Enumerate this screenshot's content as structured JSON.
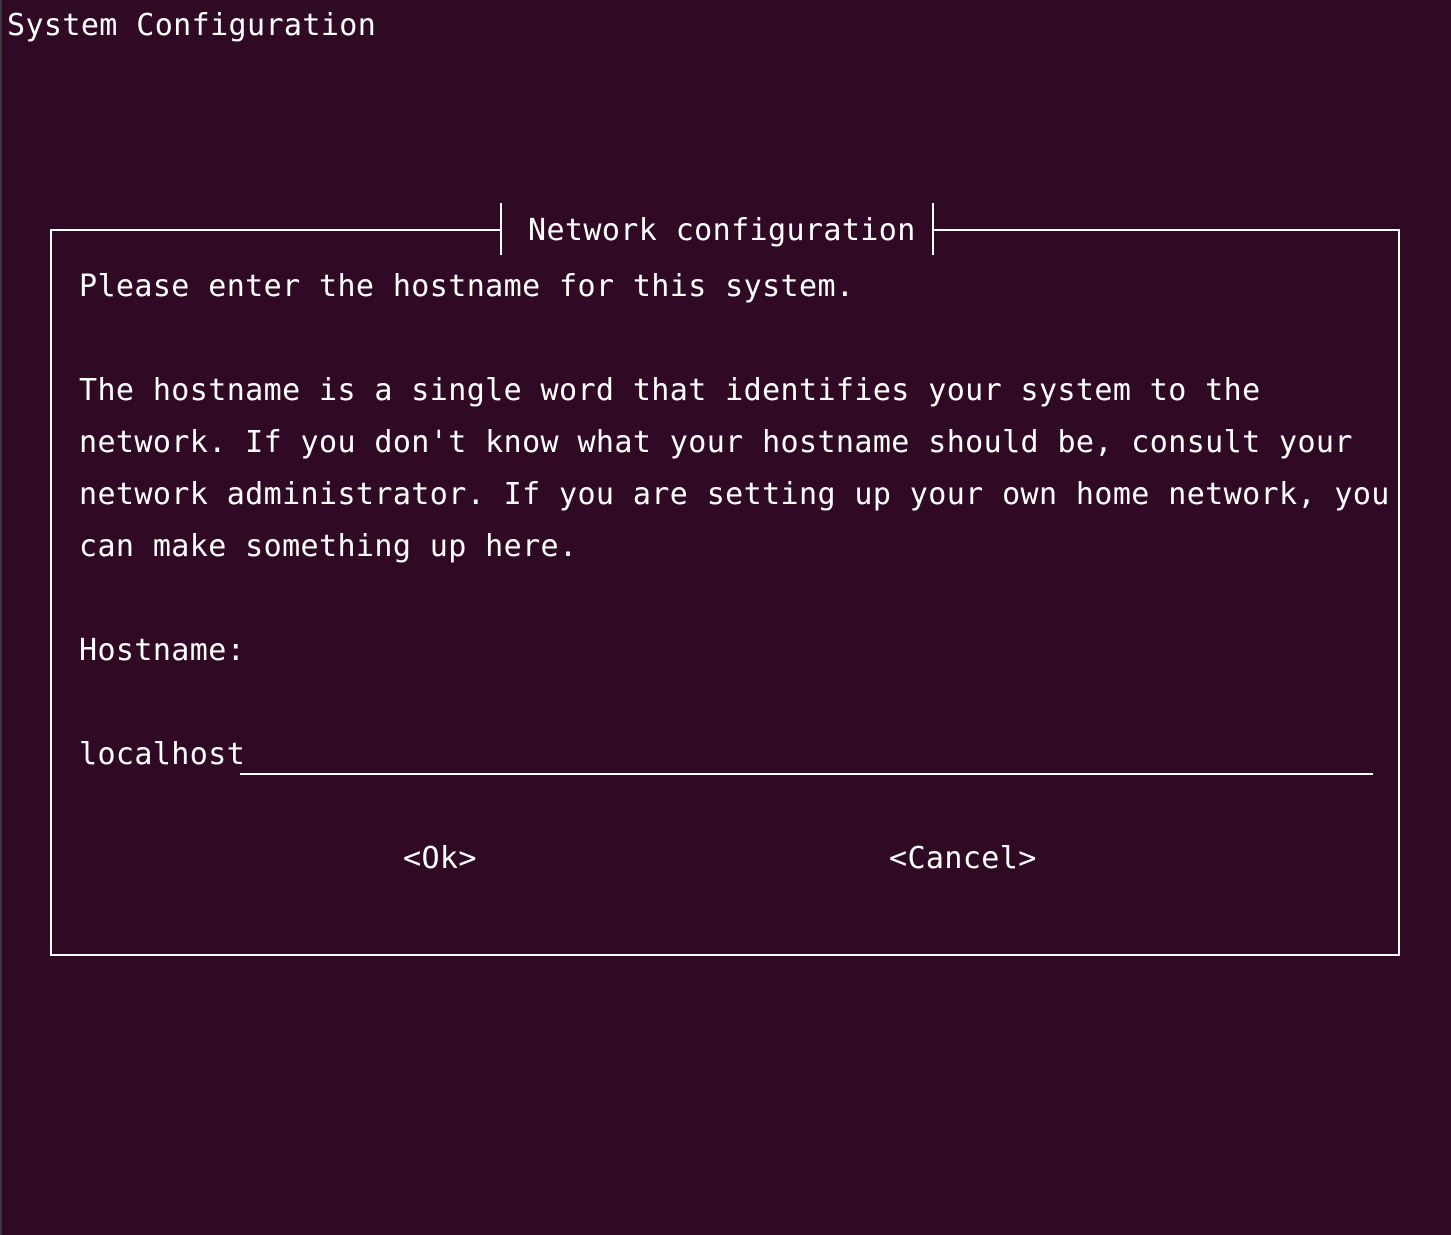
{
  "screen": {
    "title": "System Configuration"
  },
  "dialog": {
    "title": "Network configuration",
    "prompt": "Please enter the hostname for this system.",
    "description_lines": [
      "The hostname is a single word that identifies your system to the",
      "network. If you don't know what your hostname should be, consult your",
      "network administrator. If you are setting up your own home network, you",
      "can make something up here."
    ],
    "field_label": "Hostname:",
    "field_value": "localhost",
    "buttons": {
      "ok": "<Ok>",
      "cancel": "<Cancel>"
    }
  },
  "colors": {
    "background": "#300a24",
    "foreground": "#ffffff"
  }
}
